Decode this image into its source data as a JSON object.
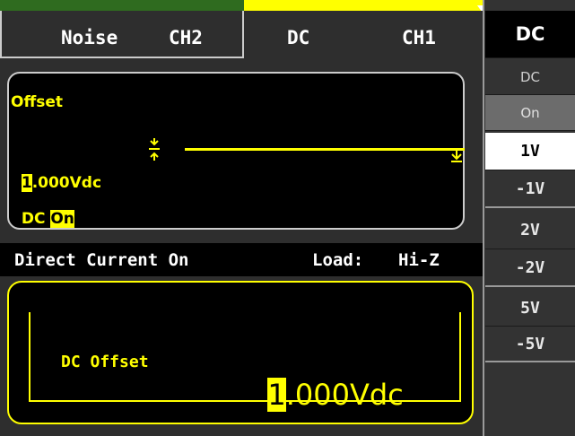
{
  "tabs": {
    "ch2": {
      "waveform": "Noise",
      "channel": "CH2"
    },
    "ch1": {
      "waveform": "DC",
      "channel": "CH1"
    }
  },
  "waveform_panel": {
    "param_label": "Offset",
    "value_cursor": "1",
    "value_rest": ".000Vdc",
    "dc_label": "DC",
    "dc_state": "On"
  },
  "status_bar": {
    "left": "Direct Current On",
    "load_label": "Load:",
    "load_value": "Hi-Z"
  },
  "entry_panel": {
    "label": "DC Offset",
    "value_cursor": "1",
    "value_rest": ".000Vdc"
  },
  "softkeys": {
    "menu_title": "DC",
    "dc_toggle": {
      "label": "DC",
      "value": "On"
    },
    "pair1": {
      "top": "1V",
      "bottom": "-1V"
    },
    "pair2": {
      "top": "2V",
      "bottom": "-2V"
    },
    "pair3": {
      "top": "5V",
      "bottom": "-5V"
    }
  },
  "colors": {
    "accent": "#ffff00",
    "background": "#2e2e2e",
    "panel": "#000000",
    "ch2_indicator": "#2f6b1f"
  }
}
